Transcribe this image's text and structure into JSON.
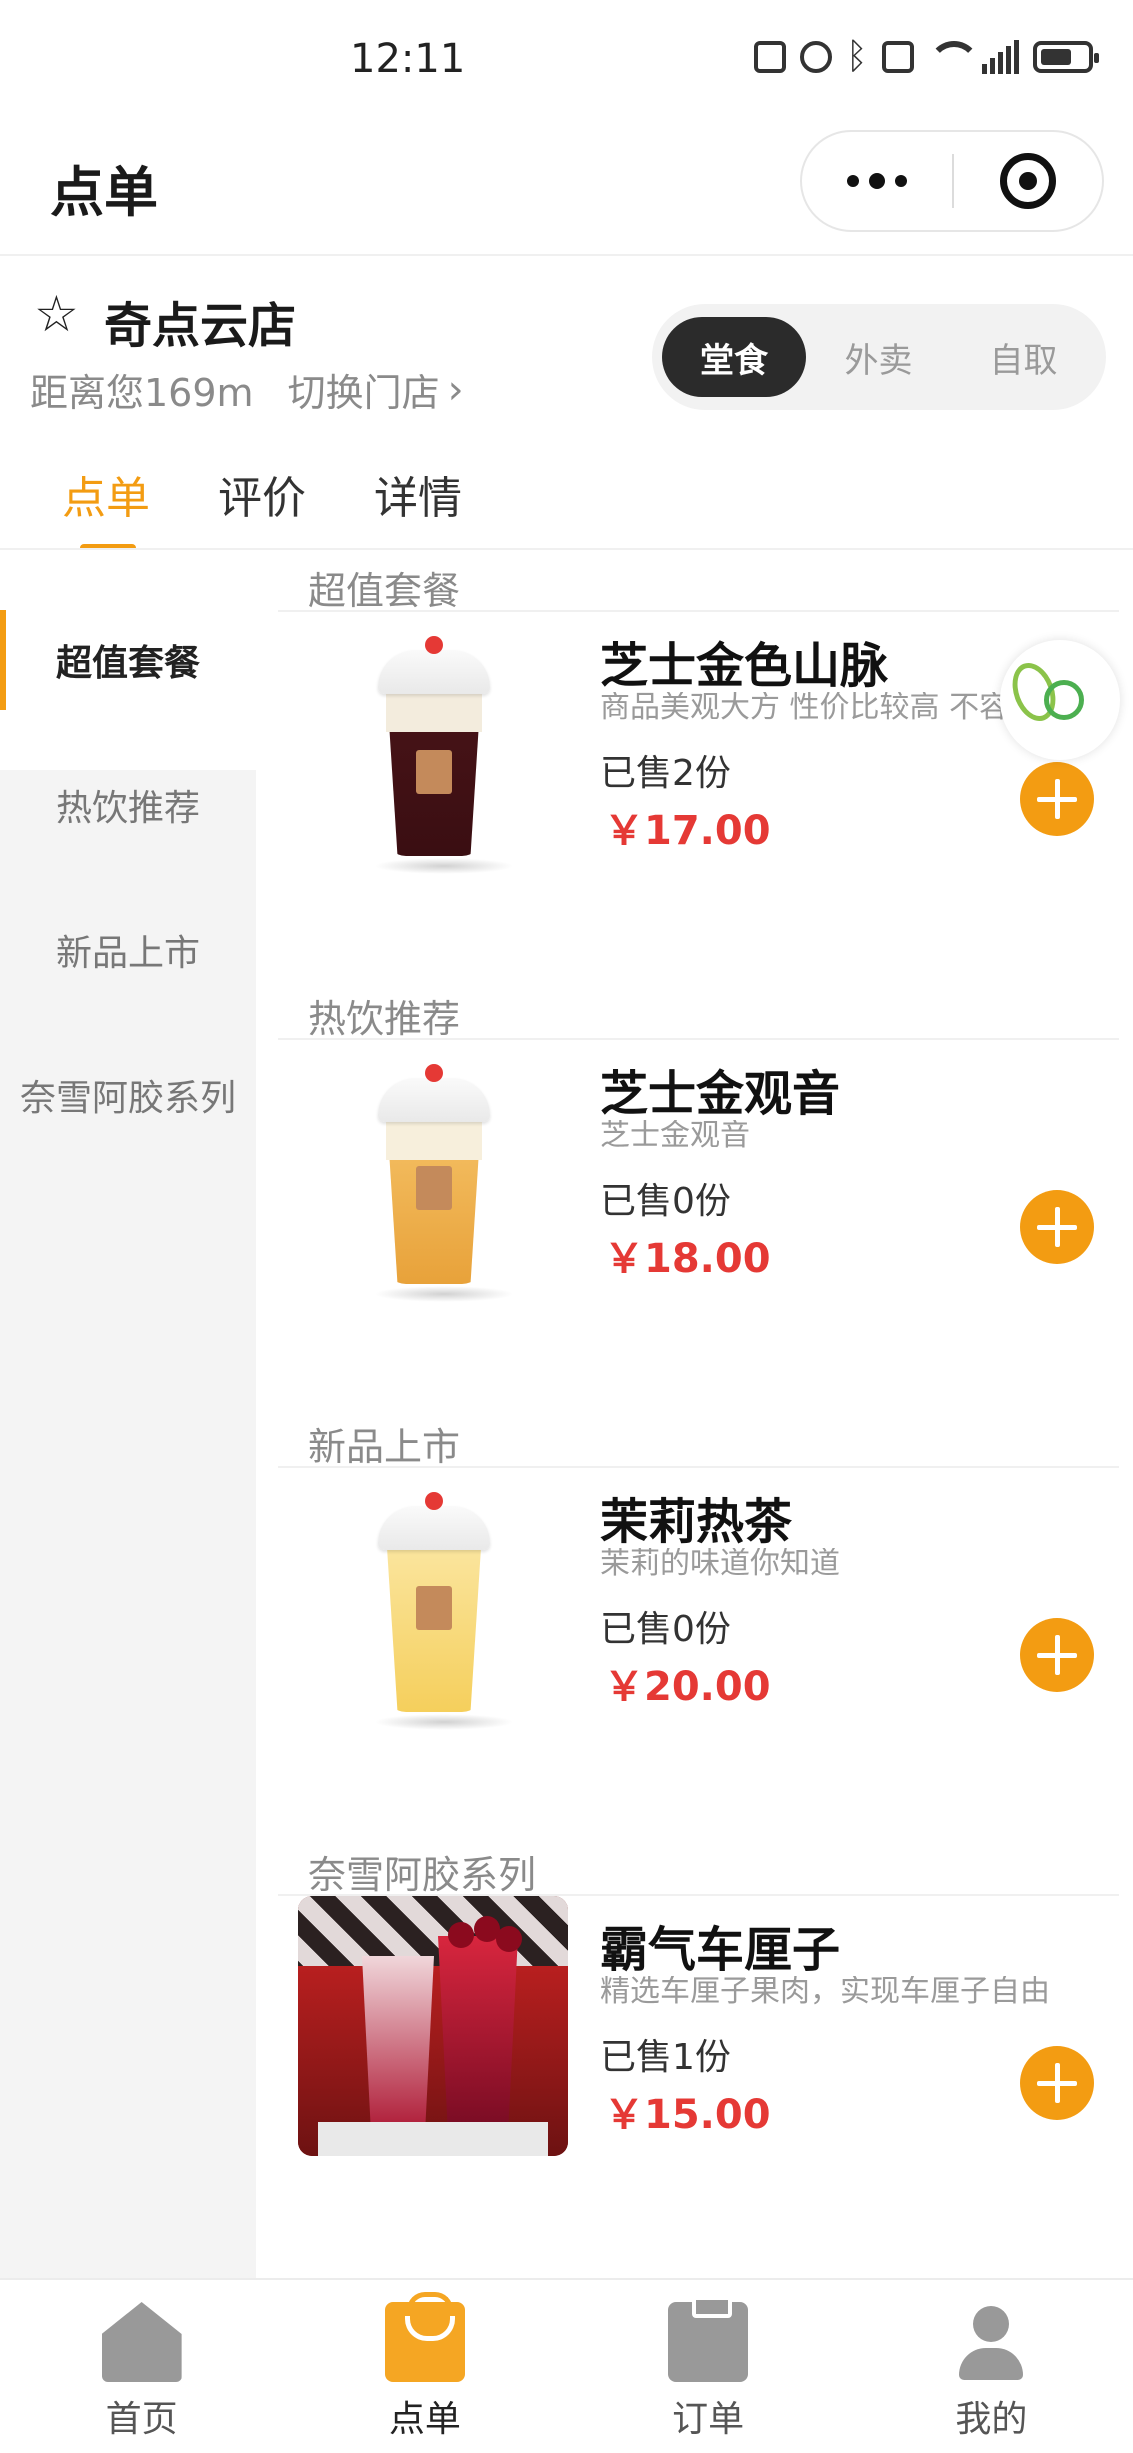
{
  "status_bar": {
    "time": "12:11",
    "network": "4G"
  },
  "nav": {
    "title": "点单"
  },
  "store": {
    "name": "奇点云店",
    "distance": "距离您169m",
    "switch_label": "切换门店",
    "modes": [
      "堂食",
      "外卖",
      "自取"
    ],
    "active_mode": "堂食"
  },
  "tabs": {
    "items": [
      "点单",
      "评价",
      "详情"
    ],
    "active": "点单"
  },
  "sidebar": {
    "items": [
      {
        "label": "超值套餐"
      },
      {
        "label": "热饮推荐"
      },
      {
        "label": "新品上市"
      },
      {
        "label": "奈雪阿胶系列"
      }
    ],
    "active": "超值套餐"
  },
  "sections": [
    {
      "title": "超值套餐",
      "product": {
        "name": "芝士金色山脉",
        "desc": "商品美观大方 性价比较高 不容错过",
        "sold": "已售2份",
        "price": "￥17.00",
        "image": "milk-tea-cup-dark-icon"
      }
    },
    {
      "title": "热饮推荐",
      "product": {
        "name": "芝士金观音",
        "desc": "芝士金观音",
        "sold": "已售0份",
        "price": "￥18.00",
        "image": "tea-cup-amber-icon"
      }
    },
    {
      "title": "新品上市",
      "product": {
        "name": "茉莉热茶",
        "desc": "茉莉的味道你知道",
        "sold": "已售0份",
        "price": "￥20.00",
        "image": "tea-cup-yellow-icon"
      }
    },
    {
      "title": "奈雪阿胶系列",
      "product": {
        "name": "霸气车厘子",
        "desc": "精选车厘子果肉，实现车厘子自由",
        "sold": "已售1份",
        "price": "￥15.00",
        "image": "cherry-drink-promo-image"
      }
    }
  ],
  "tabbar": {
    "items": [
      {
        "label": "首页",
        "icon": "home-icon"
      },
      {
        "label": "点单",
        "icon": "shopping-bag-icon"
      },
      {
        "label": "订单",
        "icon": "clipboard-icon"
      },
      {
        "label": "我的",
        "icon": "user-icon"
      }
    ],
    "active": "点单"
  },
  "colors": {
    "accent": "#f39c12",
    "price": "#e53935",
    "active_mode_bg": "#2b2b2b",
    "sidebar_bg": "#f4f4f4"
  }
}
